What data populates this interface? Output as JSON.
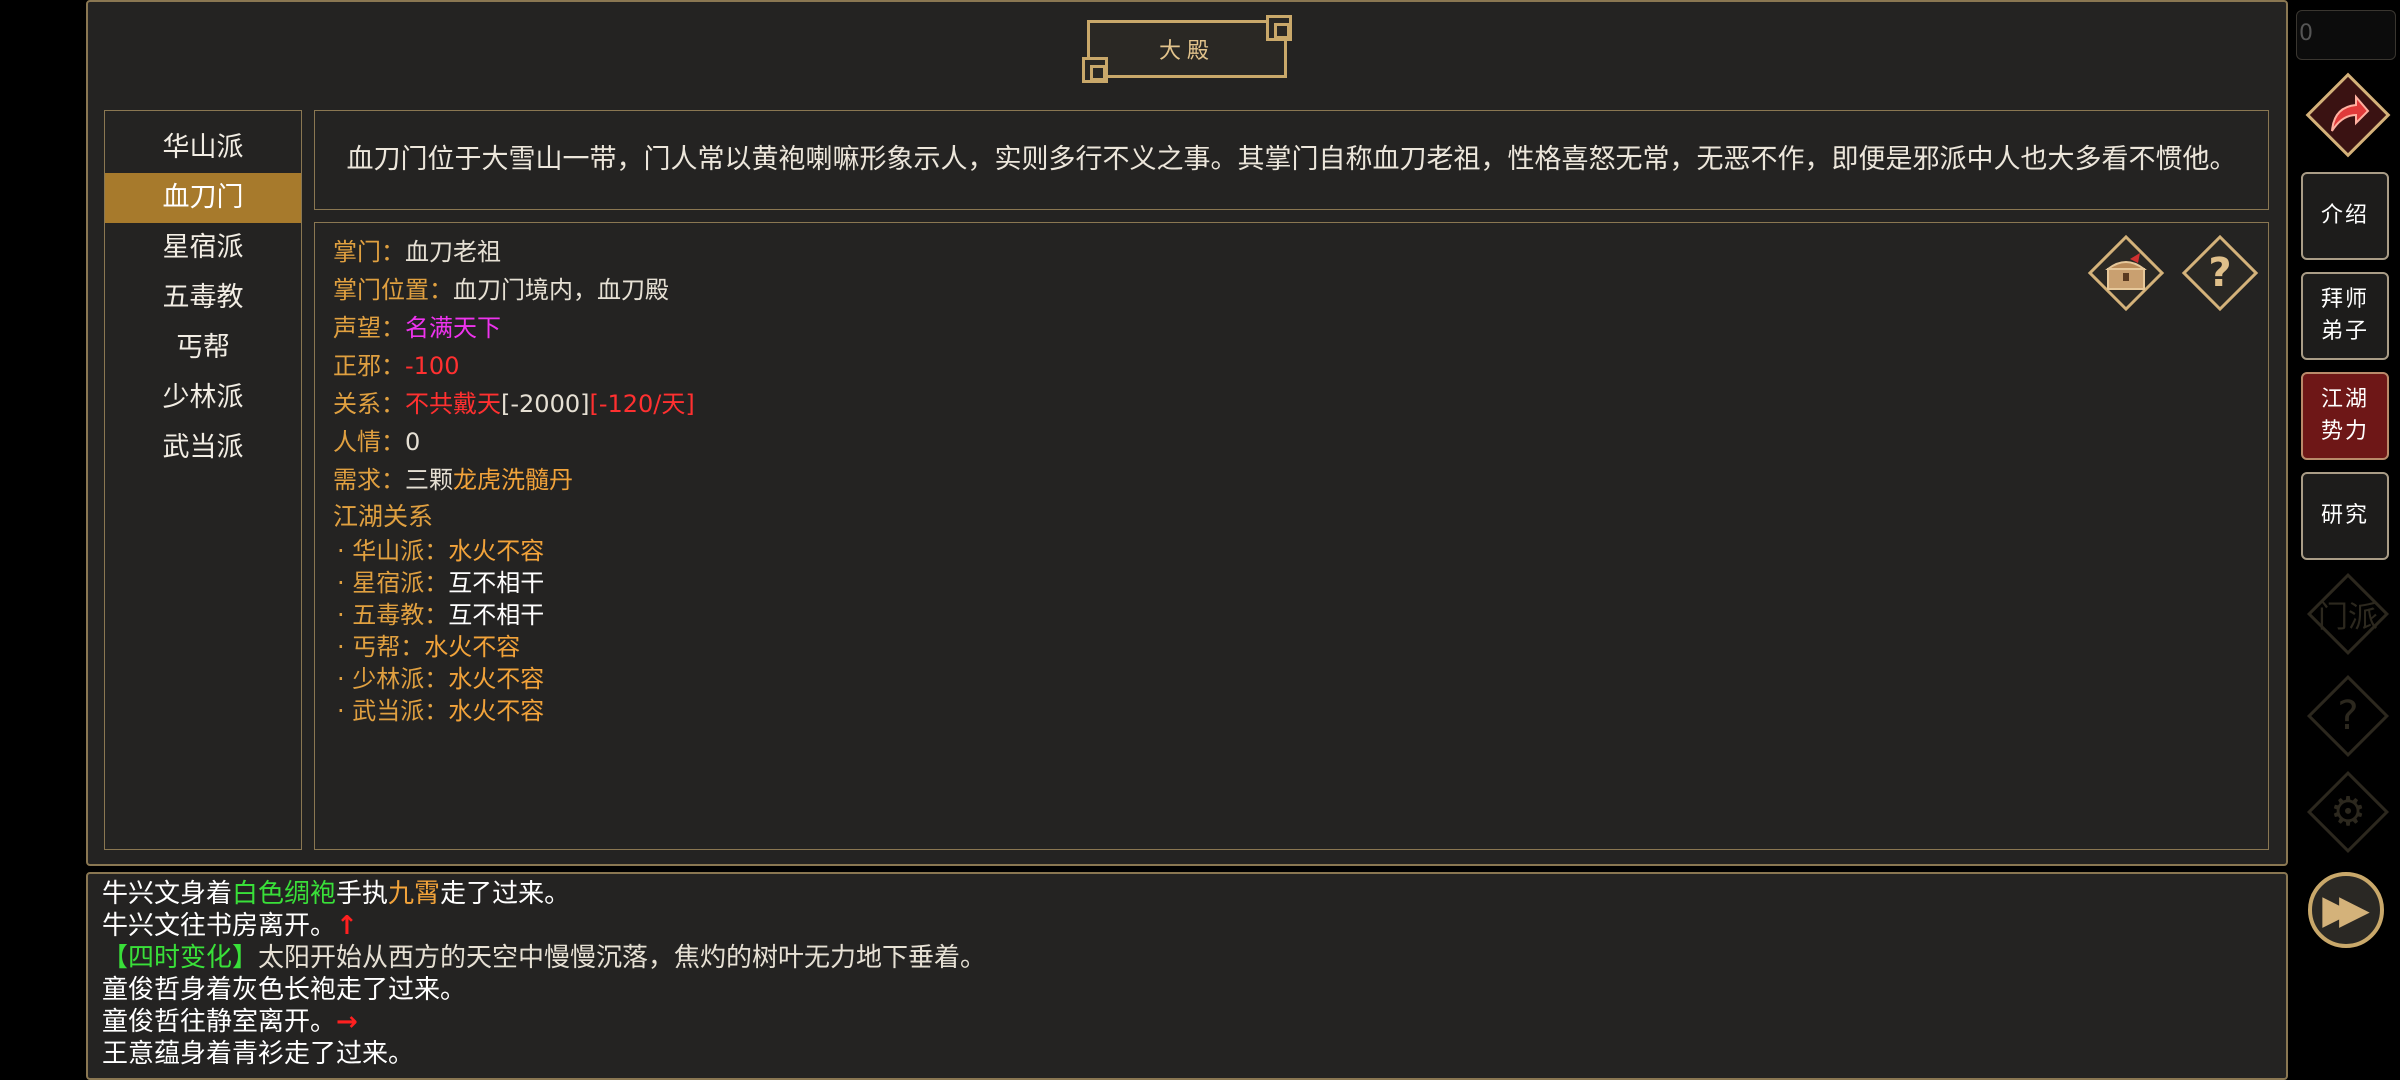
{
  "title": "大殿",
  "sects": [
    "华山派",
    "血刀门",
    "星宿派",
    "五毒教",
    "丐帮",
    "少林派",
    "武当派"
  ],
  "active_sect_index": 1,
  "description": "血刀门位于大雪山一带，门人常以黄袍喇嘛形象示人，实则多行不义之事。其掌门自称血刀老祖，性格喜怒无常，无恶不作，即便是邪派中人也大多看不惯他。",
  "info": {
    "master_label": "掌门：",
    "master": "血刀老祖",
    "location_label": "掌门位置：",
    "location": "血刀门境内，血刀殿",
    "prestige_label": "声望：",
    "prestige": "名满天下",
    "alignment_label": "正邪：",
    "alignment": "-100",
    "relation_label": "关系：",
    "relation": "不共戴天",
    "relation_value": "[-2000]",
    "relation_rate": "[-120/天]",
    "favor_label": "人情：",
    "favor": "0",
    "need_label": "需求：",
    "need_prefix": "三颗",
    "need_item": "龙虎洗髓丹",
    "relations_heading": "江湖关系",
    "relations": [
      {
        "name": "· 华山派：",
        "status": "水火不容"
      },
      {
        "name": "· 星宿派：",
        "status": "互不相干"
      },
      {
        "name": "· 五毒教：",
        "status": "互不相干"
      },
      {
        "name": "· 丐帮：",
        "status": "水火不容"
      },
      {
        "name": "· 少林派：",
        "status": "水火不容"
      },
      {
        "name": "· 武当派：",
        "status": "水火不容"
      }
    ]
  },
  "icons": {
    "chest": "treasure-chest-icon",
    "help": "?"
  },
  "log": {
    "line1_a": "牛兴文身着",
    "line1_b": "白色绸袍",
    "line1_c": "手执",
    "line1_d": "九霄",
    "line1_e": "走了过来。",
    "line2_a": "牛兴文往书房离开。",
    "line2_arrow": "↑",
    "line3_a": "【四时变化】",
    "line3_b": "太阳开始从西方的天空中慢慢沉落，焦灼的树叶无力地下垂着。",
    "line4": "童俊哲身着灰色长袍走了过来。",
    "line5_a": "童俊哲往静室离开。",
    "line5_arrow": "→",
    "line6": "王意蕴身着青衫走了过来。"
  },
  "rail": {
    "top_input": "0",
    "intro": "介绍",
    "apprentice": "拜师弟子",
    "jianghu": "江湖势力",
    "research": "研究",
    "faded_sect": "门派",
    "faded_help": "?",
    "faded_gear": "⚙",
    "forward": "▶▶"
  },
  "colors": {
    "accent_gold": "#c9a86a",
    "active_sect": "#a77a2c",
    "label_orange": "#e0a040",
    "pink": "#ee33ee",
    "red": "#ff3030",
    "green": "#39e039",
    "active_rail": "#6e1717"
  }
}
